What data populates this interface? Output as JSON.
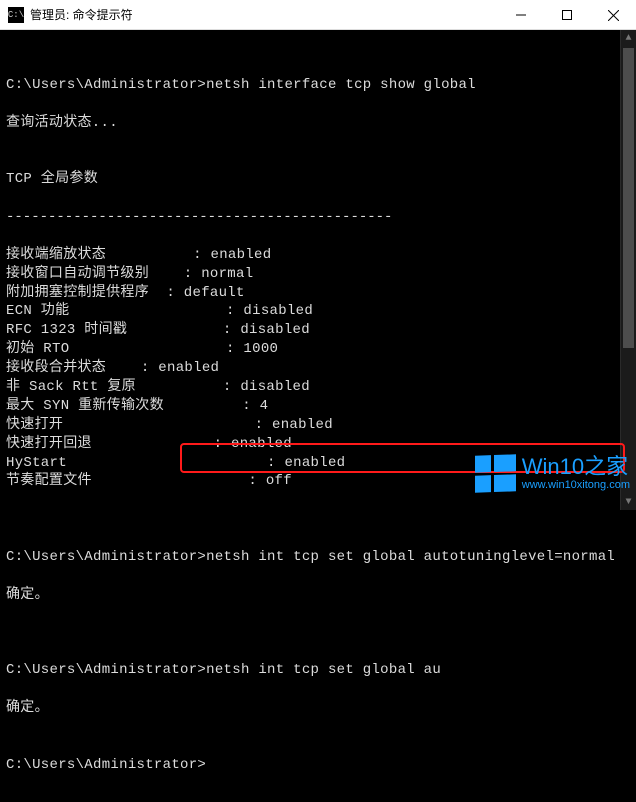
{
  "titlebar": {
    "icon_label": "C:\\",
    "title": "管理员: 命令提示符"
  },
  "terminal": {
    "prompt1": "C:\\Users\\Administrator>",
    "cmd1": "netsh interface tcp show global",
    "querying": "查询活动状态...",
    "blank": "",
    "section_title": "TCP 全局参数",
    "dashes": "----------------------------------------------",
    "rows": [
      {
        "label": "接收端缩放状态",
        "pad": "          ",
        "value": ": enabled"
      },
      {
        "label": "接收窗口自动调节级别",
        "pad": "    ",
        "value": ": normal"
      },
      {
        "label": "附加拥塞控制提供程序",
        "pad": "  ",
        "value": ": default"
      },
      {
        "label": "ECN 功能",
        "pad": "                  ",
        "value": ": disabled"
      },
      {
        "label": "RFC 1323 时间戳",
        "pad": "           ",
        "value": ": disabled"
      },
      {
        "label": "初始 RTO",
        "pad": "                  ",
        "value": ": 1000"
      },
      {
        "label": "接收段合并状态",
        "pad": "    ",
        "value": ": enabled"
      },
      {
        "label": "非 Sack Rtt 复原",
        "pad": "          ",
        "value": ": disabled"
      },
      {
        "label": "最大 SYN 重新传输次数",
        "pad": "         ",
        "value": ": 4"
      },
      {
        "label": "快速打开",
        "pad": "                      ",
        "value": ": enabled"
      },
      {
        "label": "快速打开回退",
        "pad": "              ",
        "value": ": enabled"
      },
      {
        "label": "HyStart",
        "pad": "                       ",
        "value": ": enabled"
      },
      {
        "label": "节奏配置文件",
        "pad": "                  ",
        "value": ": off"
      }
    ],
    "prompt2": "C:\\Users\\Administrator>",
    "cmd2": "netsh int tcp set global autotuninglevel=normal",
    "ok2": "确定。",
    "prompt3": "C:\\Users\\Administrator>",
    "cmd3": "netsh int tcp set global au",
    "ok3": "确定。",
    "prompt4": "C:\\Users\\Administrator>"
  },
  "watermark": {
    "main": "Win10之家",
    "sub": "www.win10xitong.com"
  }
}
